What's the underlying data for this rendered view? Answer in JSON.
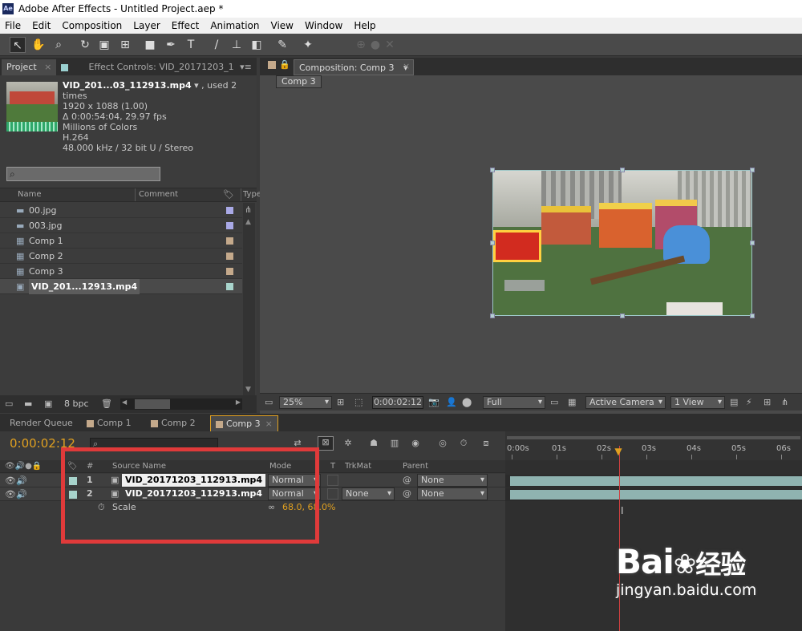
{
  "window": {
    "title": "Adobe After Effects - Untitled Project.aep *",
    "app_icon": "Ae"
  },
  "menu": [
    "File",
    "Edit",
    "Composition",
    "Layer",
    "Effect",
    "Animation",
    "View",
    "Window",
    "Help"
  ],
  "project_panel": {
    "tab_project": "Project",
    "tab_effect_controls": "Effect Controls: VID_20171203_1",
    "selected": {
      "name": "VID_201...03_112913.mp4",
      "used": ", used 2 times",
      "dimensions": "1920 x 1088 (1.00)",
      "duration": "Δ 0:00:54:04, 29.97 fps",
      "colors": "Millions of Colors",
      "codec": "H.264",
      "audio": "48.000 kHz / 32 bit U / Stereo"
    },
    "search_placeholder": "",
    "columns": {
      "name": "Name",
      "comment": "Comment",
      "type": "Type"
    },
    "items": [
      {
        "name": "00.jpg",
        "kind": "image",
        "color": "#a9a9e6"
      },
      {
        "name": "003.jpg",
        "kind": "image",
        "color": "#a9a9e6"
      },
      {
        "name": "Comp 1",
        "kind": "comp",
        "color": "#c4a98b"
      },
      {
        "name": "Comp 2",
        "kind": "comp",
        "color": "#c4a98b"
      },
      {
        "name": "Comp 3",
        "kind": "comp",
        "color": "#c4a98b"
      },
      {
        "name": "VID_201...12913.mp4",
        "kind": "video",
        "color": "#a8d4cc"
      }
    ],
    "bpc": "8 bpc"
  },
  "composition_panel": {
    "tab": "Composition: Comp 3",
    "breadcrumb": "Comp 3",
    "zoom": "25%",
    "timecode": "0:00:02:12",
    "resolution": "Full",
    "camera": "Active Camera",
    "view": "1 View"
  },
  "timeline": {
    "tabs": [
      "Render Queue",
      "Comp 1",
      "Comp 2",
      "Comp 3"
    ],
    "timecode": "0:00:02:12",
    "columns": {
      "number": "#",
      "source": "Source Name",
      "mode": "Mode",
      "t": "T",
      "trkmat": "TrkMat",
      "parent": "Parent"
    },
    "layers": [
      {
        "num": "1",
        "name": "VID_20171203_112913.mp4",
        "mode": "Normal",
        "trkmat": "",
        "parent": "None"
      },
      {
        "num": "2",
        "name": "VID_20171203_112913.mp4",
        "mode": "Normal",
        "trkmat": "None",
        "parent": "None"
      }
    ],
    "property": {
      "name": "Scale",
      "value": "68.0, 68.0%"
    },
    "ruler": [
      "0:00s",
      "01s",
      "02s",
      "03s",
      "04s",
      "05s",
      "06s"
    ],
    "playhead_seconds": 2.4
  },
  "watermark": {
    "brand": "Bai",
    "cn": "经验",
    "url": "jingyan.baidu.com"
  },
  "colors": {
    "accent_orange": "#e0a020",
    "highlight_box": "#e03a3a",
    "playhead": "#d04040"
  }
}
